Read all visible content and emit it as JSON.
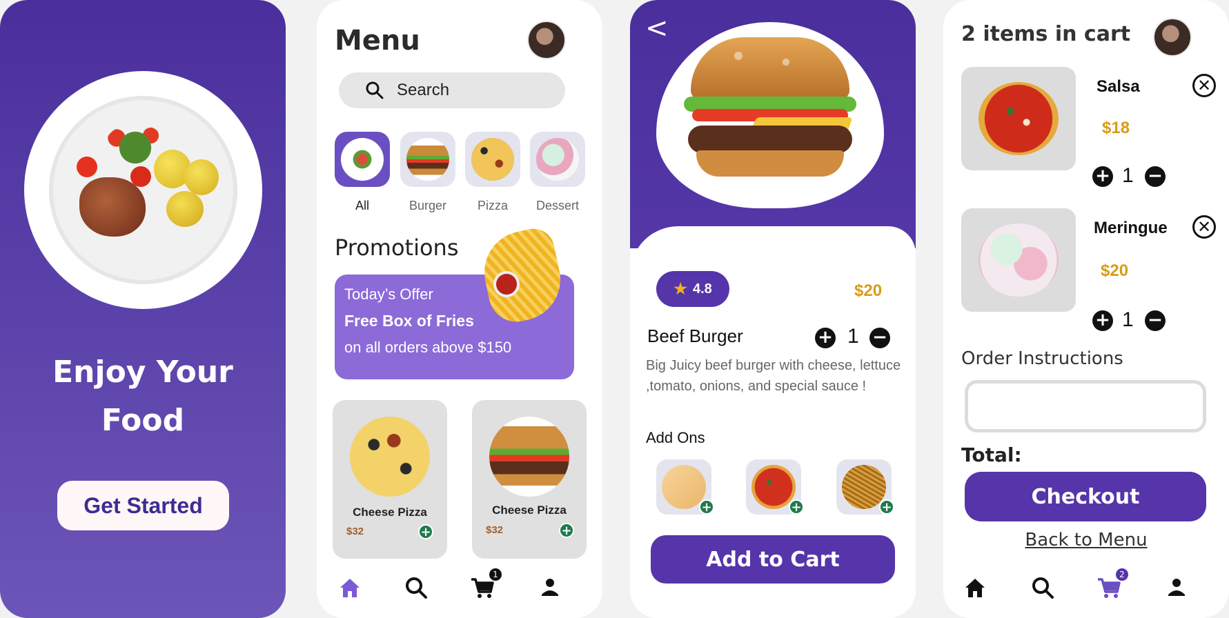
{
  "colors": {
    "primary": "#5535a9",
    "accent_yellow": "#d99c16",
    "green": "#1f7a4c",
    "promo": "#8c6ad8"
  },
  "welcome": {
    "headline_line1": "Enjoy Your",
    "headline_line2": "Food",
    "cta_label": "Get Started"
  },
  "menu": {
    "title": "Menu",
    "search_placeholder": "Search",
    "categories": [
      {
        "label": "All",
        "active": true,
        "icon": "plate-icon"
      },
      {
        "label": "Burger",
        "active": false,
        "icon": "burger-icon"
      },
      {
        "label": "Pizza",
        "active": false,
        "icon": "pizza-icon"
      },
      {
        "label": "Dessert",
        "active": false,
        "icon": "dessert-icon"
      }
    ],
    "promotions_title": "Promotions",
    "promo": {
      "line1": "Today’s Offer",
      "line2": "Free Box of Fries",
      "line3": "on all orders above $150"
    },
    "products": [
      {
        "name": "Cheese Pizza",
        "price": "$32",
        "image": "pizza"
      },
      {
        "name": "Cheese Pizza",
        "price": "$32",
        "image": "burger"
      }
    ],
    "nav": {
      "cart_badge": "1",
      "active": "home"
    }
  },
  "detail": {
    "back_label": "<",
    "rating": "4.8",
    "price": "$20",
    "name": "Beef Burger",
    "quantity": "1",
    "description": "Big Juicy beef burger with cheese, lettuce ,tomato, onions, and special sauce !",
    "addons_title": "Add Ons",
    "addons": [
      {
        "name": "cheese",
        "icon": "cheese-icon"
      },
      {
        "name": "salsa",
        "icon": "salsa-icon"
      },
      {
        "name": "noodles",
        "icon": "noodles-icon"
      }
    ],
    "add_to_cart_label": "Add to Cart"
  },
  "cart": {
    "title": "2 items in cart",
    "items": [
      {
        "name": "Salsa",
        "price": "$18",
        "quantity": "1"
      },
      {
        "name": "Meringue",
        "price": "$20",
        "quantity": "1"
      }
    ],
    "instructions_label": "Order Instructions",
    "instructions_value": "",
    "total_label": "Total:",
    "checkout_label": "Checkout",
    "back_label": "Back to Menu",
    "nav": {
      "cart_badge": "2",
      "active": "cart"
    }
  }
}
